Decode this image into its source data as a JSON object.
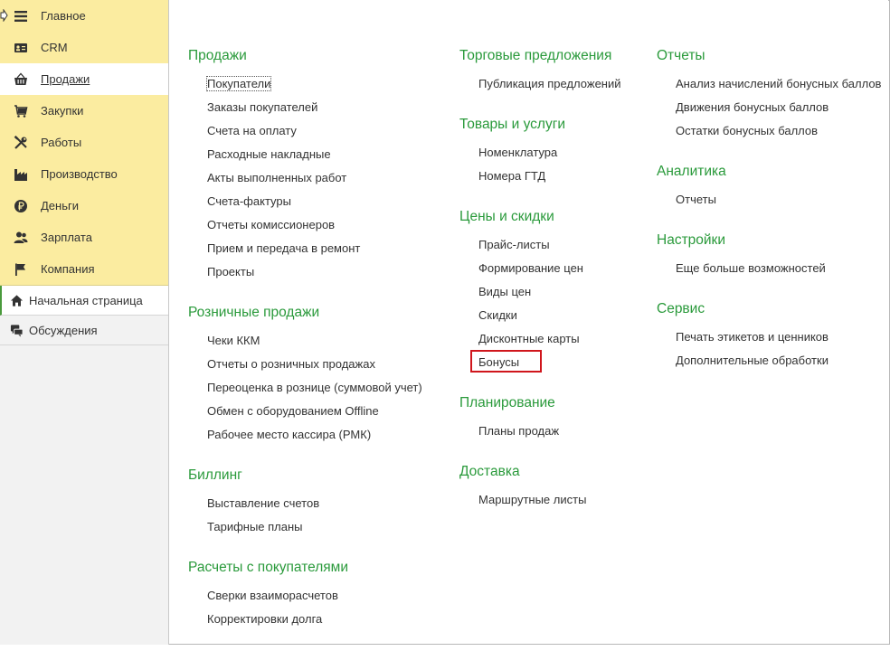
{
  "sidebar": {
    "sections": [
      {
        "label": "Главное",
        "icon": "menu-lines-icon"
      },
      {
        "label": "CRM",
        "icon": "contact-card-icon"
      },
      {
        "label": "Продажи",
        "icon": "basket-icon",
        "active": true
      },
      {
        "label": "Закупки",
        "icon": "cart-icon"
      },
      {
        "label": "Работы",
        "icon": "tools-icon"
      },
      {
        "label": "Производство",
        "icon": "factory-icon"
      },
      {
        "label": "Деньги",
        "icon": "ruble-coin-icon"
      },
      {
        "label": "Зарплата",
        "icon": "people-icon"
      },
      {
        "label": "Компания",
        "icon": "flag-icon"
      }
    ],
    "nav": [
      {
        "label": "Начальная страница",
        "icon": "home-icon"
      },
      {
        "label": "Обсуждения",
        "icon": "chat-bubbles-icon"
      }
    ]
  },
  "main": {
    "columns": [
      [
        {
          "title": "Продажи",
          "links": [
            "Покупатели",
            "Заказы покупателей",
            "Счета на оплату",
            "Расходные накладные",
            "Акты выполненных работ",
            "Счета-фактуры",
            "Отчеты комиссионеров",
            "Прием и передача в ремонт",
            "Проекты"
          ]
        },
        {
          "title": "Розничные продажи",
          "links": [
            "Чеки ККМ",
            "Отчеты о розничных продажах",
            "Переоценка в рознице (суммовой учет)",
            "Обмен с оборудованием Offline",
            "Рабочее место кассира (РМК)"
          ]
        },
        {
          "title": "Биллинг",
          "links": [
            "Выставление счетов",
            "Тарифные планы"
          ]
        },
        {
          "title": "Расчеты с покупателями",
          "links": [
            "Сверки взаиморасчетов",
            "Корректировки долга"
          ]
        }
      ],
      [
        {
          "title": "Торговые предложения",
          "links": [
            "Публикация предложений"
          ]
        },
        {
          "title": "Товары и услуги",
          "links": [
            "Номенклатура",
            "Номера ГТД"
          ]
        },
        {
          "title": "Цены и скидки",
          "links": [
            "Прайс-листы",
            "Формирование цен",
            "Виды цен",
            "Скидки",
            "Дисконтные карты",
            "Бонусы"
          ]
        },
        {
          "title": "Планирование",
          "links": [
            "Планы продаж"
          ]
        },
        {
          "title": "Доставка",
          "links": [
            "Маршрутные листы"
          ]
        }
      ],
      [
        {
          "title": "Отчеты",
          "links": [
            "Анализ начислений бонусных баллов",
            "Движения бонусных баллов",
            "Остатки бонусных баллов"
          ]
        },
        {
          "title": "Аналитика",
          "links": [
            "Отчеты"
          ]
        },
        {
          "title": "Настройки",
          "links": [
            "Еще больше возможностей"
          ]
        },
        {
          "title": "Сервис",
          "links": [
            "Печать этикетов и ценников",
            "Дополнительные обработки"
          ]
        }
      ]
    ]
  },
  "colors": {
    "group_title": "#2a9a3b",
    "sections_bg": "#fbeca0",
    "highlight": "#d0161c",
    "selected_marker": "#4a9a3c"
  }
}
